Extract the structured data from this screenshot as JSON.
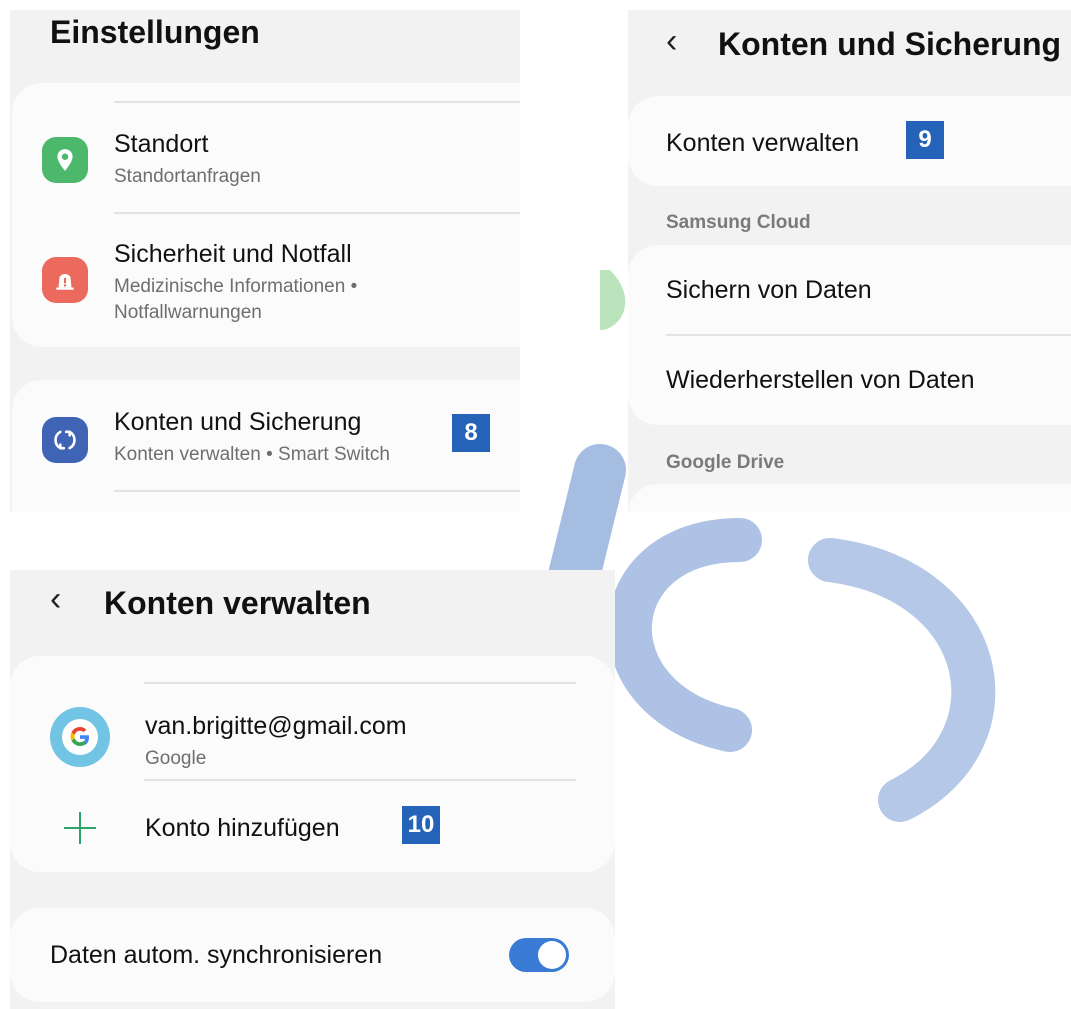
{
  "panel1": {
    "title": "Einstellungen",
    "items": [
      {
        "title": "Standort",
        "subtitle": "Standortanfragen"
      },
      {
        "title": "Sicherheit und Notfall",
        "subtitle_line1": "Medizinische Informationen  •",
        "subtitle_line2": "Notfallwarnungen"
      },
      {
        "title": "Konten und Sicherung",
        "subtitle": "Konten verwalten  •  Smart Switch",
        "badge": "8"
      }
    ],
    "colors": {
      "location": "#4cb86c",
      "safety": "#ec6a5d",
      "accounts": "#3f63b5"
    }
  },
  "panel2": {
    "title": "Konten und Sicherung",
    "manage": {
      "label": "Konten verwalten",
      "badge": "9"
    },
    "section_samsung": "Samsung Cloud",
    "backup": "Sichern von Daten",
    "restore": "Wiederherstellen von Daten",
    "section_google": "Google Drive"
  },
  "panel3": {
    "title": "Konten verwalten",
    "account": {
      "email": "van.brigitte@gmail.com",
      "provider": "Google"
    },
    "add": {
      "label": "Konto hinzufügen",
      "badge": "10"
    },
    "sync": {
      "label": "Daten autom. synchronisieren",
      "enabled": true
    }
  },
  "colors": {
    "badge": "#2563b8",
    "accent": "#3a7bd5",
    "add_plus": "#2ea36a"
  }
}
